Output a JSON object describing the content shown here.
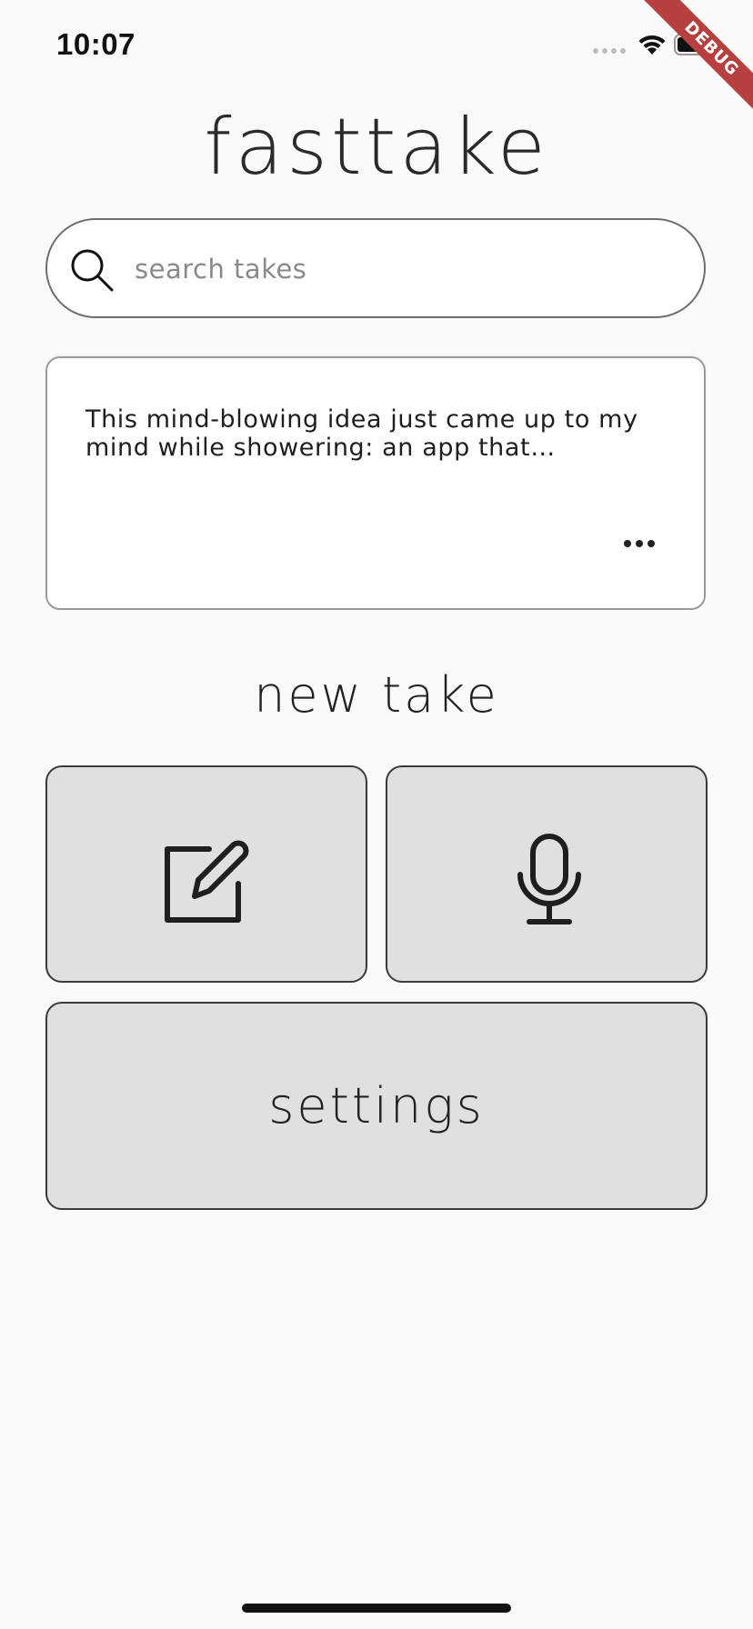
{
  "status_bar": {
    "time": "10:07"
  },
  "debug_banner": {
    "label": "DEBUG"
  },
  "header": {
    "title": "fasttake"
  },
  "search": {
    "placeholder": "search takes",
    "value": ""
  },
  "takes": [
    {
      "text": "This mind-blowing idea just came up to my mind while showering: an app that…"
    }
  ],
  "new_take": {
    "title": "new take",
    "text_button_icon": "edit-icon",
    "voice_button_icon": "microphone-icon"
  },
  "settings": {
    "label": "settings"
  },
  "colors": {
    "background": "#fafafa",
    "tile": "#e0e0e0",
    "debug": "#b5403f"
  }
}
